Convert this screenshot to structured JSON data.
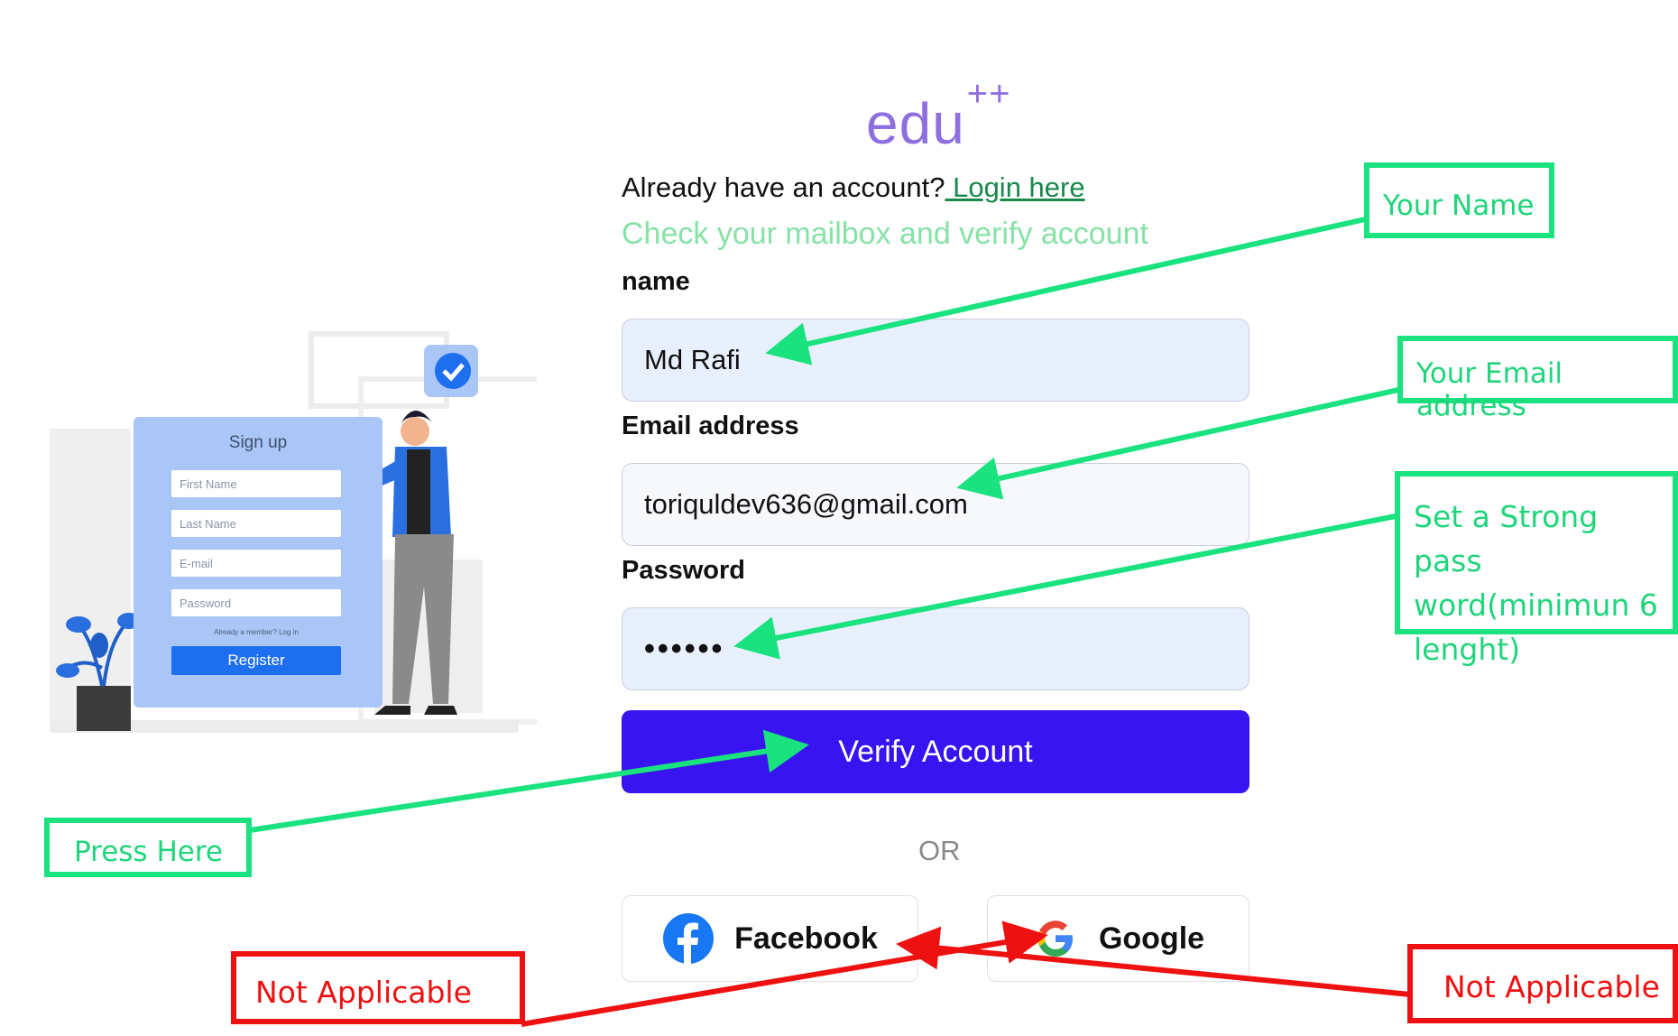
{
  "logo": {
    "text": "edu",
    "sup": "++"
  },
  "login_prompt": {
    "text": "Already have an account?",
    "link": " Login here"
  },
  "notice": "Check your mailbox and verify account",
  "fields": {
    "name": {
      "label": "name",
      "value": "Md Rafi"
    },
    "email": {
      "label": "Email address",
      "value": "toriquldev636@gmail.com"
    },
    "password": {
      "label": "Password",
      "value": "••••••"
    }
  },
  "verify_button": "Verify Account",
  "divider": "OR",
  "social": {
    "facebook": "Facebook",
    "google": "Google"
  },
  "illustration": {
    "title": "Sign up",
    "fields": [
      "First Name",
      "Last Name",
      "E-mail",
      "Password"
    ],
    "small_text": "Already a member? Log in",
    "button": "Register"
  },
  "annotations": {
    "your_name": "Your Name",
    "your_email": "Your Email address",
    "password_hint": [
      "Set a Strong pass",
      "word(minimun 6",
      "lenght)"
    ],
    "press_here": "Press Here",
    "not_applicable_left": "Not Applicable",
    "not_applicable_right": "Not Applicable"
  },
  "colors": {
    "primary_button": "#3714f0",
    "logo": "#8f6fe0",
    "notice": "#86e2a6",
    "annotation_green": "#1ae27f",
    "annotation_red": "#ee1111"
  }
}
